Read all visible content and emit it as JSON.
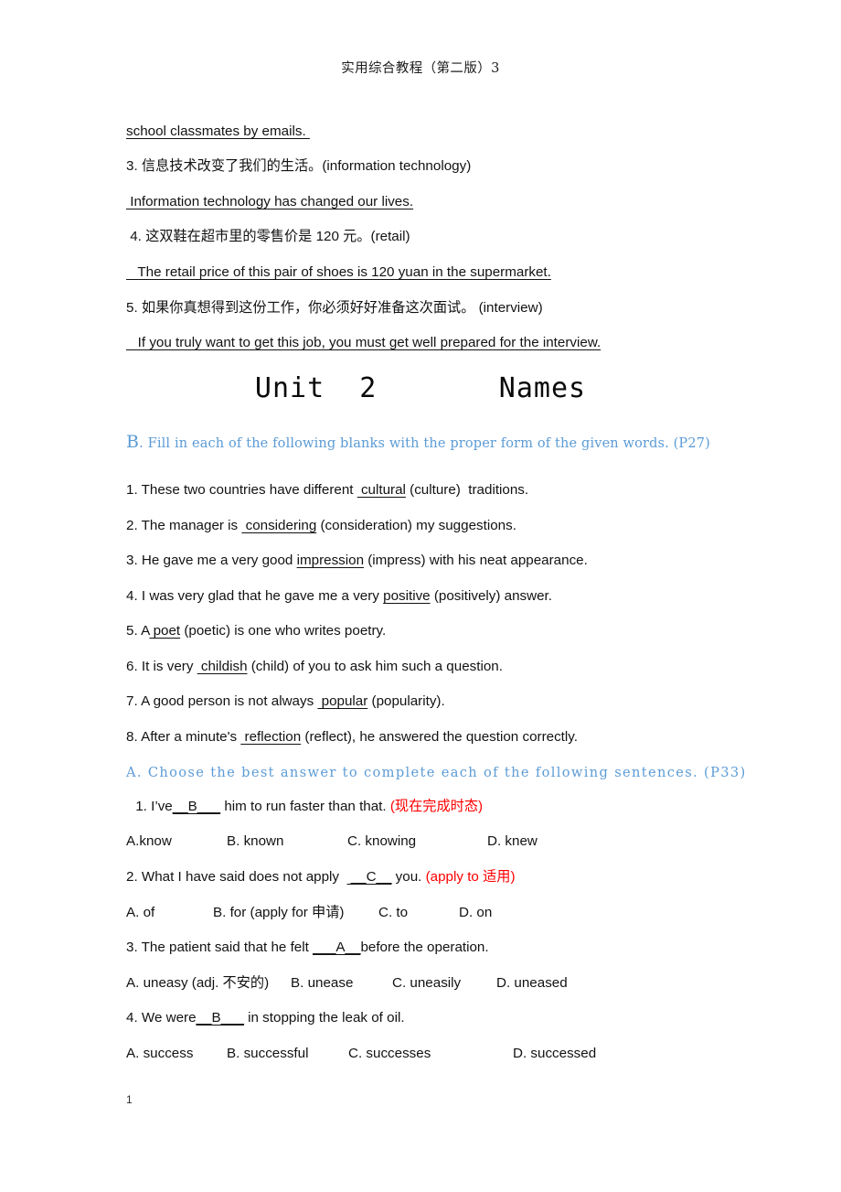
{
  "document": {
    "running_header": "实用综合教程（第二版）3",
    "page_number": "1",
    "accent_blue": "#5b9bd5",
    "annotation_red": "#ff0000"
  },
  "translation_exercise": {
    "continuation_line": "school classmates by emails. ",
    "items": [
      {
        "prompt": "3. 信息技术改变了我们的生活。(information technology)",
        "answer": " Information technology has changed our lives."
      },
      {
        "prompt": " 4. 这双鞋在超市里的零售价是 120 元。(retail)",
        "answer": "   The retail price of this pair of shoes is 120 yuan in the supermarket."
      },
      {
        "prompt": "5. 如果你真想得到这份工作，你必须好好准备这次面试。 (interview)",
        "answer": "   If you truly want to get this job, you must get well prepared for the interview."
      }
    ]
  },
  "unit_title": {
    "text": "Unit  2       Names"
  },
  "section_b": {
    "letter": "B",
    "heading": ". Fill in each of the following blanks with the proper form of the given words. (P27)",
    "items": [
      {
        "number": "1. ",
        "before": "These two countries have different ",
        "answer": " cultural",
        "after": " (culture)  traditions."
      },
      {
        "number": "2. ",
        "before": "The manager is ",
        "answer": " considering",
        "after": " (consideration) my suggestions."
      },
      {
        "number": "3. ",
        "before": "He gave me a very good ",
        "answer": "impression",
        "after": " (impress) with his neat appearance."
      },
      {
        "number": "4. ",
        "before": "I was very glad that he gave me a very ",
        "answer": "positive",
        "after": " (positively) answer."
      },
      {
        "number": "5. ",
        "before": "A",
        "answer": " poet",
        "after": " (poetic) is one who writes poetry."
      },
      {
        "number": "6. ",
        "before": "It is very ",
        "answer": " childish",
        "after": " (child) of you to ask him such a question."
      },
      {
        "number": "7. ",
        "before": "A good person is not always ",
        "answer": " popular",
        "after": " (popularity)."
      },
      {
        "number": "8. ",
        "before": "After a minute's ",
        "answer": " reflection",
        "after": " (reflect), he answered the question correctly."
      }
    ]
  },
  "section_a": {
    "heading": "A. Choose the best answer to complete each of the following sentences. (P33)",
    "questions": [
      {
        "number": " 1. ",
        "before": "I’ve",
        "answer": "__B___",
        "after": " him to run faster than that. ",
        "note": "(现在完成时态)",
        "options": [
          "A.know",
          "B. known",
          "C. knowing",
          "D. knew"
        ]
      },
      {
        "number": "2. ",
        "before": "What I have said does not apply  ",
        "answer": " __C__",
        "after": " you. ",
        "note": "(apply to 适用)",
        "options": [
          "A. of",
          "B. for (apply for 申请)",
          "C. to",
          "D. on"
        ]
      },
      {
        "number": "3. ",
        "before": "The patient said that he felt ",
        "answer": "___A__",
        "after": "before the operation.",
        "note": "",
        "options": [
          "A. uneasy (adj. 不安的)",
          "B. unease",
          "C. uneasily",
          "D. uneased"
        ]
      },
      {
        "number": "4. ",
        "before": "We were",
        "answer": "__B___",
        "after": " in stopping the leak of oil.",
        "note": "",
        "options": [
          "A. success",
          "B. successful",
          "C. successes",
          "D. successed"
        ]
      }
    ]
  }
}
